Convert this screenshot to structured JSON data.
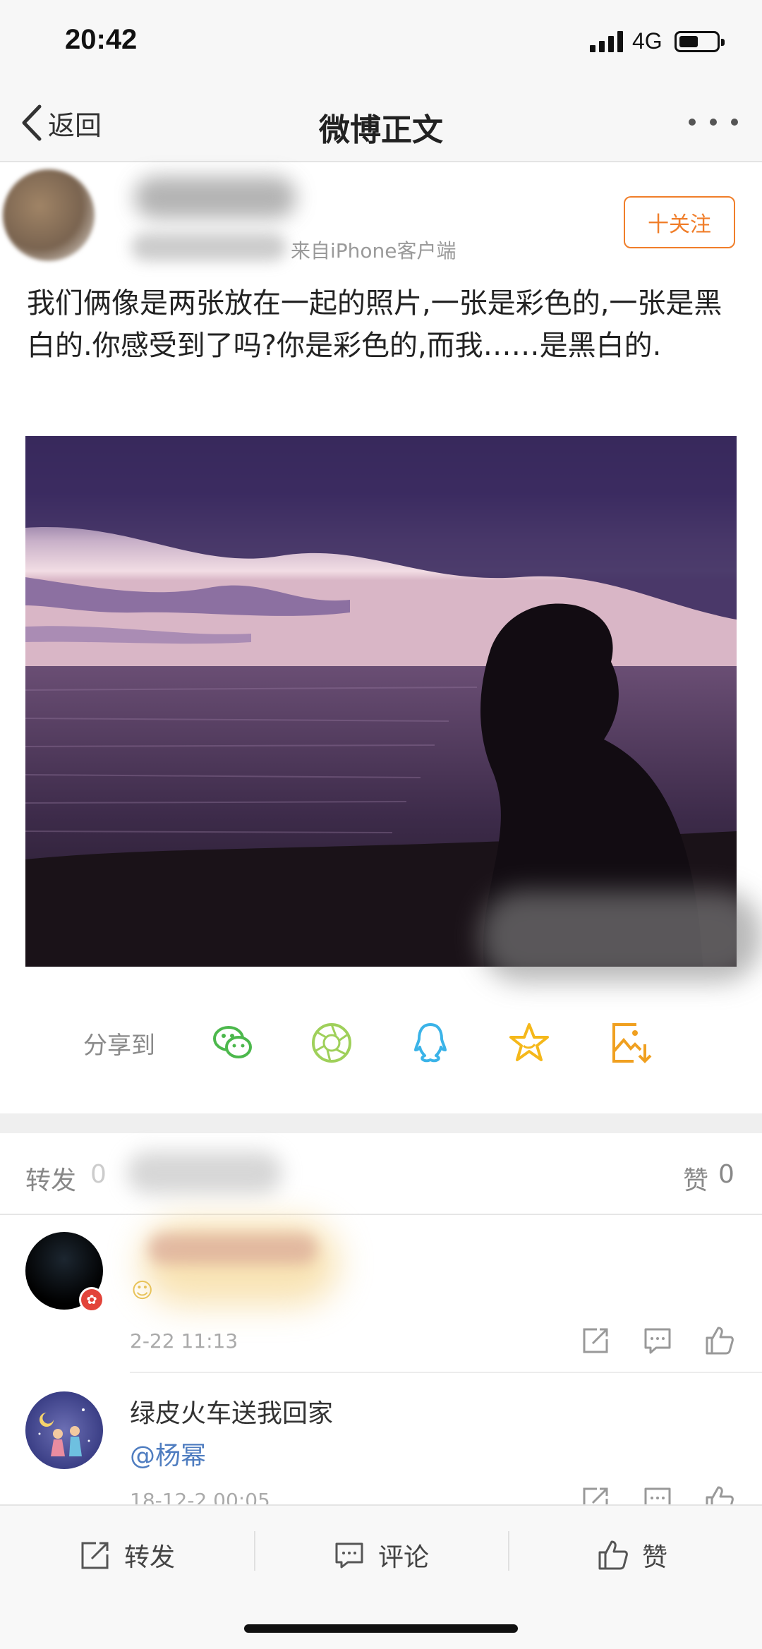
{
  "status_bar": {
    "time": "20:42",
    "network": "4G"
  },
  "nav": {
    "back_label": "返回",
    "title": "微博正文"
  },
  "post": {
    "source": "来自iPhone客户端",
    "follow_label": "十关注",
    "text": "我们俩像是两张放在一起的照片,一张是彩色的,一张是黑白的.你感受到了吗?你是彩色的,而我……是黑白的."
  },
  "share": {
    "label": "分享到",
    "icons": [
      "wechat-icon",
      "moments-icon",
      "qq-icon",
      "favorite-icon",
      "save-image-icon"
    ]
  },
  "counts": {
    "repost_label": "转发",
    "repost_count": "0",
    "like_label": "赞",
    "like_count": "0"
  },
  "comments": [
    {
      "time": "2-22 11:13"
    },
    {
      "text": "绿皮火车送我回家",
      "mention": "@杨幂",
      "time": "18-12-2 00:05"
    }
  ],
  "toolbar": {
    "repost": "转发",
    "comment": "评论",
    "like": "赞"
  },
  "colors": {
    "accent": "#f07e2a",
    "mention": "#4f7dc0",
    "wechat": "#4cb84c",
    "moments": "#9fd05a",
    "qq": "#3ab3e8",
    "star": "#f5b81a"
  }
}
